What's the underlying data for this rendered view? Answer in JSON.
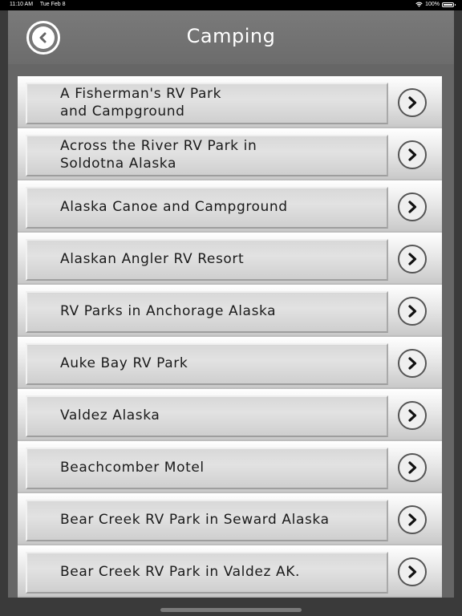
{
  "status_bar": {
    "time": "11:10 AM",
    "date": "Tue Feb 8",
    "battery": "100%",
    "wifi_icon": "wifi-icon",
    "battery_icon": "battery-icon"
  },
  "header": {
    "title": "Camping",
    "back_icon": "chevron-left-circle-icon"
  },
  "list": {
    "arrow_icon": "chevron-right-circle-icon",
    "items": [
      {
        "label": "A Fisherman's RV Park\nand Campground"
      },
      {
        "label": "Across the River RV Park in\nSoldotna Alaska"
      },
      {
        "label": "Alaska Canoe and Campground"
      },
      {
        "label": "Alaskan Angler RV Resort"
      },
      {
        "label": "RV Parks in Anchorage Alaska"
      },
      {
        "label": "Auke Bay RV Park"
      },
      {
        "label": "Valdez Alaska"
      },
      {
        "label": "Beachcomber Motel"
      },
      {
        "label": "Bear Creek RV Park in Seward Alaska"
      },
      {
        "label": "Bear Creek RV Park in Valdez AK."
      }
    ]
  },
  "colors": {
    "header": "#6f6f6f",
    "background": "#3a3a3a",
    "row": "#e0e0e0"
  }
}
